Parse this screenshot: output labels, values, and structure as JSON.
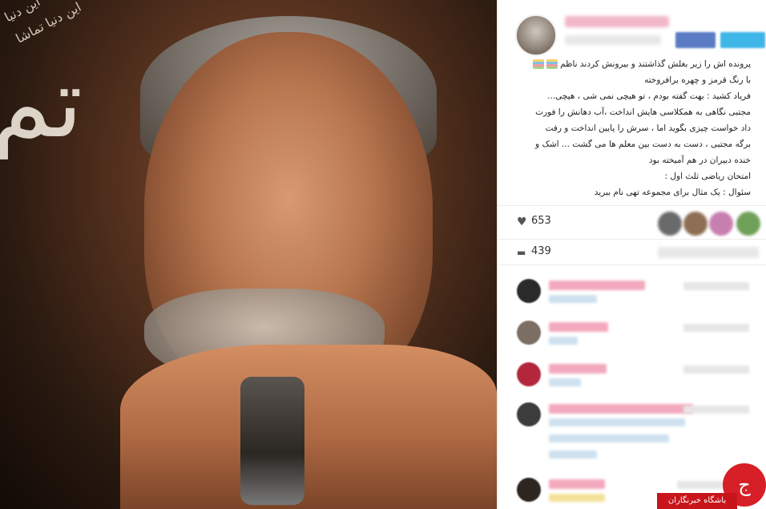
{
  "photo": {
    "alt": "",
    "calligraphy_lines": [
      "این دنیا",
      "این دنیا تماشا"
    ],
    "big_glyph": "تم"
  },
  "post": {
    "caption_lines": [
      "پرونده اش را زیر بغلش گذاشتند و بیرونش کردند ناظم",
      "با رنگ قرمز و چهره برافروخته",
      "فریاد کشید : بهت گفته بودم ، تو هیچی نمی شی ، هیچی...",
      "مجتبی نگاهی به همکلاسی هایش انداخت ،آب دهانش را فورت",
      "داد خواست چیزی بگوید اما ، سرش را پایین انداخت و رفت",
      "برگه مجتبی ، دست به دست بین معلم ها می گشت ... اشک و",
      "خنده دبیران در هم آمیخته بود",
      "امتحان ریاضی ثلث اول :",
      "سئوال : یک مثال برای مجموعه تهی نام ببرید"
    ],
    "likes_count": "653",
    "comments_count": "439"
  },
  "colors": {
    "like_avatars": [
      "#6a6a6a",
      "#8e6f55",
      "#c77fb0",
      "#6fa05a",
      "#4c6e8c"
    ],
    "comment_avatars": [
      "#2a2a2a",
      "#7b6e62",
      "#b3263b",
      "#3c3c3c",
      "#2d2520"
    ],
    "accent_red": "#d61f26"
  },
  "badge": {
    "logo_glyph": "ج",
    "label": "باشگاه خبرنگاران"
  },
  "icons": {
    "heart": "♥",
    "comment": "▬"
  }
}
